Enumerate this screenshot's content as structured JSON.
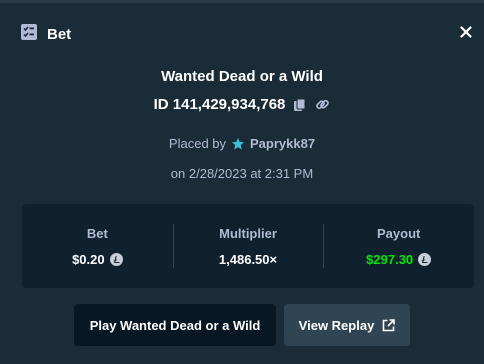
{
  "modal": {
    "title": "Bet",
    "title_icon": "bet-slip-icon",
    "close_icon": "close-icon"
  },
  "bet": {
    "game_name": "Wanted Dead or a Wild",
    "id_label": "ID 141,429,934,768",
    "placed_by_label": "Placed by",
    "username": "Paprykk87",
    "date_label": "on 2/28/2023 at 2:31 PM"
  },
  "stats": [
    {
      "label": "Bet",
      "value": "$0.20",
      "currency_icon": "litecoin-icon"
    },
    {
      "label": "Multiplier",
      "value": "1,486.50×"
    },
    {
      "label": "Payout",
      "value": "$297.30",
      "currency_icon": "litecoin-icon"
    }
  ],
  "buttons": {
    "play_label": "Play Wanted Dead or a Wild",
    "replay_label": "View Replay"
  },
  "colors": {
    "background": "#1a2c38",
    "panel": "#0f212e",
    "payout_green": "#00e701",
    "muted_text": "#b1bad3",
    "vip_star": "#39c5d8"
  }
}
